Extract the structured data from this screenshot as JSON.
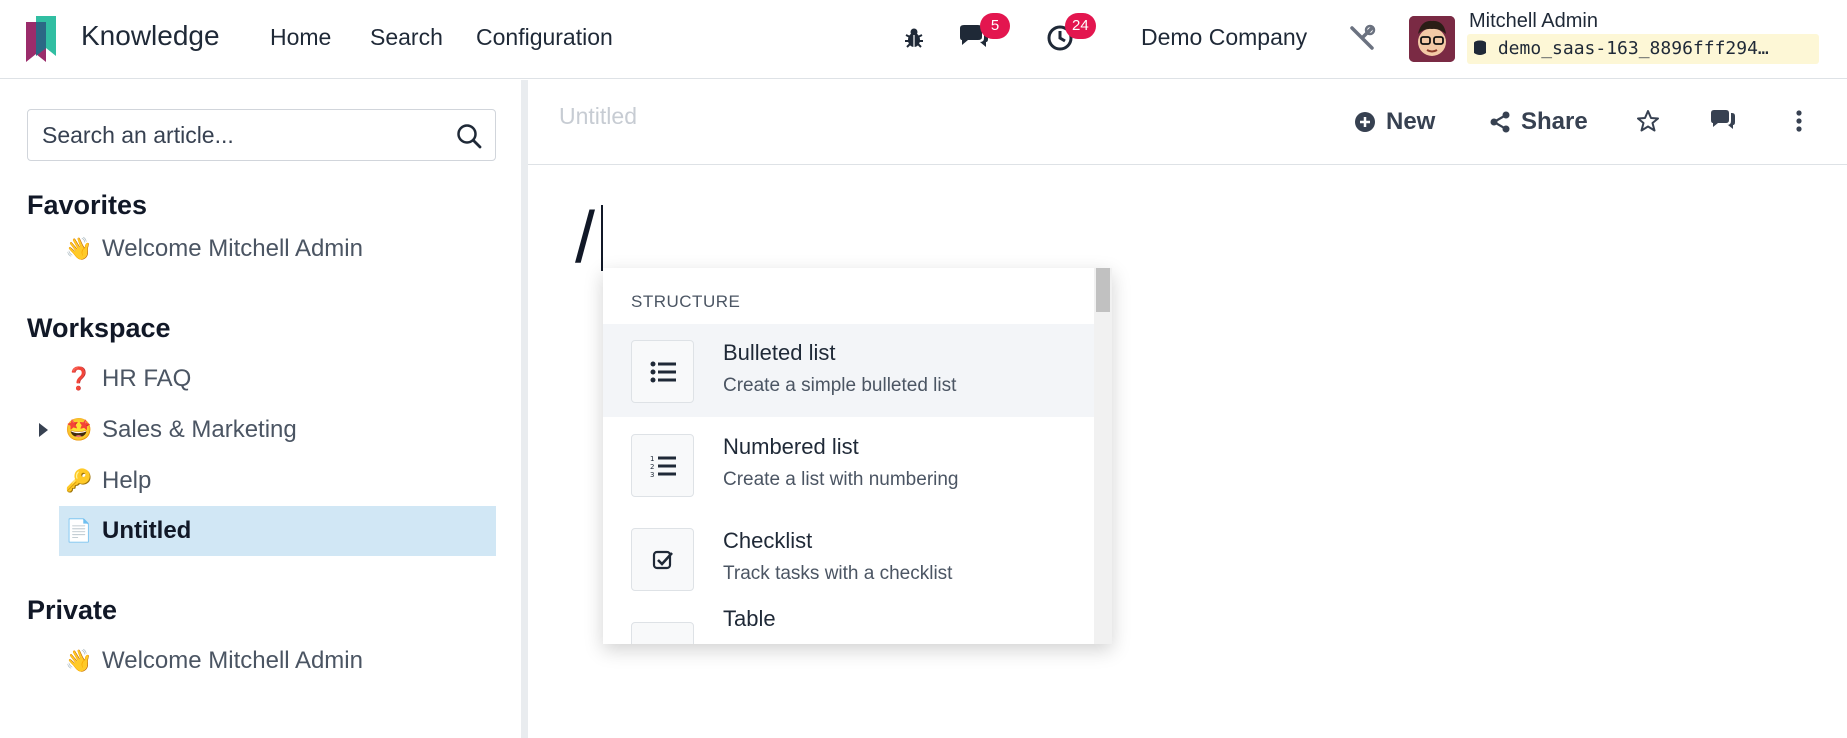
{
  "navbar": {
    "app_name": "Knowledge",
    "menu": [
      "Home",
      "Search",
      "Configuration"
    ],
    "chat_badge": "5",
    "activity_badge": "24",
    "company": "Demo Company",
    "user_name": "Mitchell Admin",
    "database": "demo_saas-163_8896fff294…",
    "icons": [
      "bug-icon",
      "chat-icon",
      "clock-icon",
      "tools-icon"
    ]
  },
  "sidebar": {
    "search_placeholder": "Search an article...",
    "favorites_title": "Favorites",
    "favorites": [
      {
        "emoji": "👋",
        "label": "Welcome Mitchell Admin"
      }
    ],
    "workspace_title": "Workspace",
    "workspace": [
      {
        "emoji": "❓",
        "label": "HR FAQ"
      },
      {
        "emoji": "🤩",
        "label": "Sales & Marketing"
      },
      {
        "emoji": "🔑",
        "label": "Help"
      },
      {
        "emoji": "📄",
        "label": "Untitled",
        "active": true
      }
    ],
    "private_title": "Private",
    "private": [
      {
        "emoji": "👋",
        "label": "Welcome Mitchell Admin"
      }
    ]
  },
  "header": {
    "title_placeholder": "Untitled",
    "new_label": "New",
    "share_label": "Share"
  },
  "editor": {
    "typed": "/"
  },
  "palette": {
    "category": "STRUCTURE",
    "commands": [
      {
        "title": "Bulleted list",
        "desc": "Create a simple bulleted list",
        "icon": "bulleted-list-icon"
      },
      {
        "title": "Numbered list",
        "desc": "Create a list with numbering",
        "icon": "numbered-list-icon"
      },
      {
        "title": "Checklist",
        "desc": "Track tasks with a checklist",
        "icon": "checklist-icon"
      },
      {
        "title": "Table",
        "desc": "",
        "icon": "table-icon"
      }
    ]
  },
  "colors": {
    "accent": "#714b67",
    "badge": "#e3164f",
    "active_item": "#d1e7f5"
  }
}
